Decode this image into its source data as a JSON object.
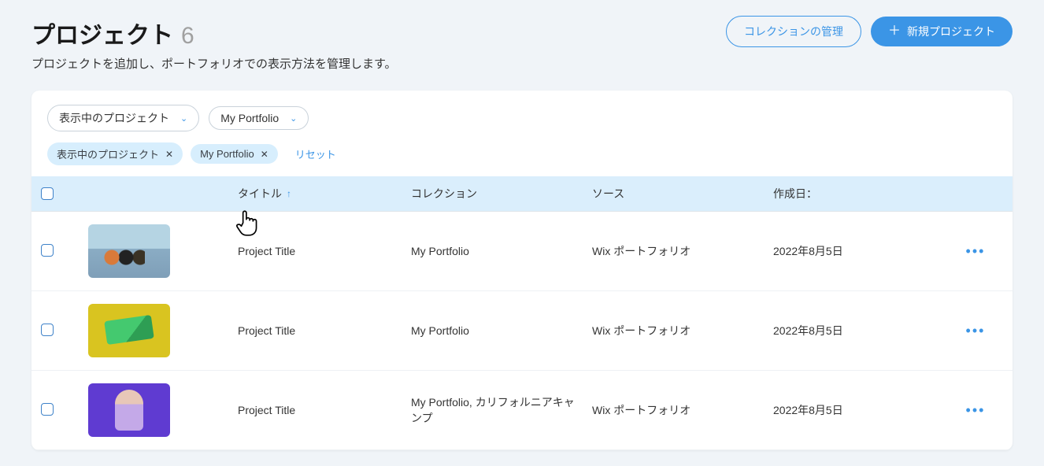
{
  "header": {
    "title": "プロジェクト",
    "count": "6",
    "subtitle": "プロジェクトを追加し、ポートフォリオでの表示方法を管理します。",
    "manage_collections": "コレクションの管理",
    "new_project": "新規プロジェクト"
  },
  "filters": {
    "status_dropdown": "表示中のプロジェクト",
    "collection_dropdown": "My Portfolio"
  },
  "chips": {
    "status": "表示中のプロジェクト",
    "collection": "My Portfolio",
    "reset": "リセット"
  },
  "columns": {
    "title": "タイトル",
    "collection": "コレクション",
    "source": "ソース",
    "created": "作成日："
  },
  "rows": [
    {
      "title": "Project Title",
      "collection": "My Portfolio",
      "source": "Wix ポートフォリオ",
      "created": "2022年8月5日"
    },
    {
      "title": "Project Title",
      "collection": "My Portfolio",
      "source": "Wix ポートフォリオ",
      "created": "2022年8月5日"
    },
    {
      "title": "Project Title",
      "collection": "My Portfolio, カリフォルニアキャンプ",
      "source": "Wix ポートフォリオ",
      "created": "2022年8月5日"
    }
  ]
}
